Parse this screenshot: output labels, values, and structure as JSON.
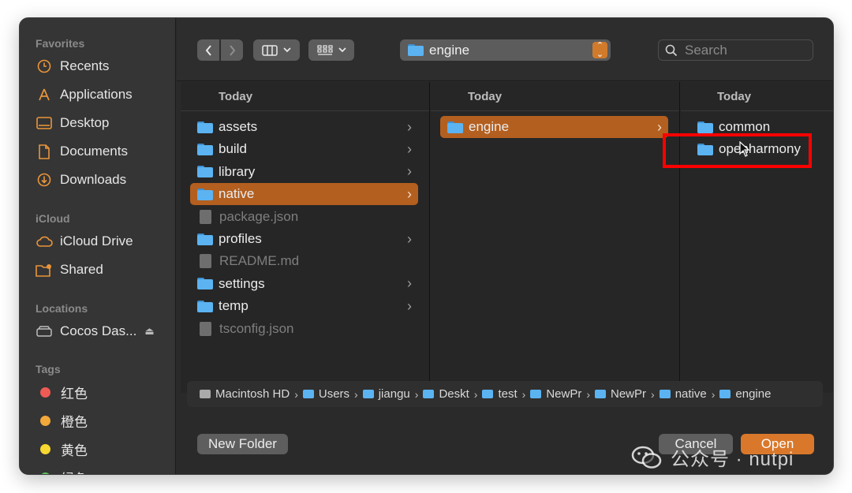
{
  "sidebar": {
    "favorites_label": "Favorites",
    "favorites": [
      {
        "label": "Recents",
        "icon": "clock-icon"
      },
      {
        "label": "Applications",
        "icon": "applications-icon"
      },
      {
        "label": "Desktop",
        "icon": "desktop-icon"
      },
      {
        "label": "Documents",
        "icon": "document-icon"
      },
      {
        "label": "Downloads",
        "icon": "download-icon"
      }
    ],
    "icloud_label": "iCloud",
    "icloud": [
      {
        "label": "iCloud Drive",
        "icon": "cloud-icon"
      },
      {
        "label": "Shared",
        "icon": "shared-folder-icon"
      }
    ],
    "locations_label": "Locations",
    "locations": [
      {
        "label": "Cocos Das...",
        "icon": "disk-icon"
      }
    ],
    "tags_label": "Tags",
    "tags": [
      {
        "label": "红色",
        "color": "#ee5b55"
      },
      {
        "label": "橙色",
        "color": "#f3a83b"
      },
      {
        "label": "黄色",
        "color": "#f6d830"
      },
      {
        "label": "绿色",
        "color": "#5cc65f"
      }
    ]
  },
  "toolbar": {
    "path_folder": "engine",
    "search_placeholder": "Search"
  },
  "columns": [
    {
      "header": "Today",
      "items": [
        {
          "name": "assets",
          "kind": "folder",
          "selected": false
        },
        {
          "name": "build",
          "kind": "folder",
          "selected": false
        },
        {
          "name": "library",
          "kind": "folder",
          "selected": false
        },
        {
          "name": "native",
          "kind": "folder",
          "selected": true
        },
        {
          "name": "package.json",
          "kind": "file",
          "selected": false
        },
        {
          "name": "profiles",
          "kind": "folder",
          "selected": false
        },
        {
          "name": "README.md",
          "kind": "file",
          "selected": false
        },
        {
          "name": "settings",
          "kind": "folder",
          "selected": false
        },
        {
          "name": "temp",
          "kind": "folder",
          "selected": false
        },
        {
          "name": "tsconfig.json",
          "kind": "file",
          "selected": false
        }
      ]
    },
    {
      "header": "Today",
      "items": [
        {
          "name": "engine",
          "kind": "folder",
          "selected": true
        }
      ]
    },
    {
      "header": "Today",
      "items": [
        {
          "name": "common",
          "kind": "folder",
          "selected": false
        },
        {
          "name": "openharmony",
          "kind": "folder",
          "selected": false
        }
      ]
    }
  ],
  "pathbar": [
    "Macintosh HD",
    "Users",
    "jiangu",
    "Deskt",
    "test",
    "NewPr",
    "NewPr",
    "native",
    "engine"
  ],
  "footer": {
    "new_folder": "New Folder",
    "cancel": "Cancel",
    "open": "Open"
  },
  "watermark": "公众号 · nutpi",
  "colors": {
    "accent": "#b35f1f",
    "open_button": "#d9782b",
    "annotation": "#ff0000"
  }
}
